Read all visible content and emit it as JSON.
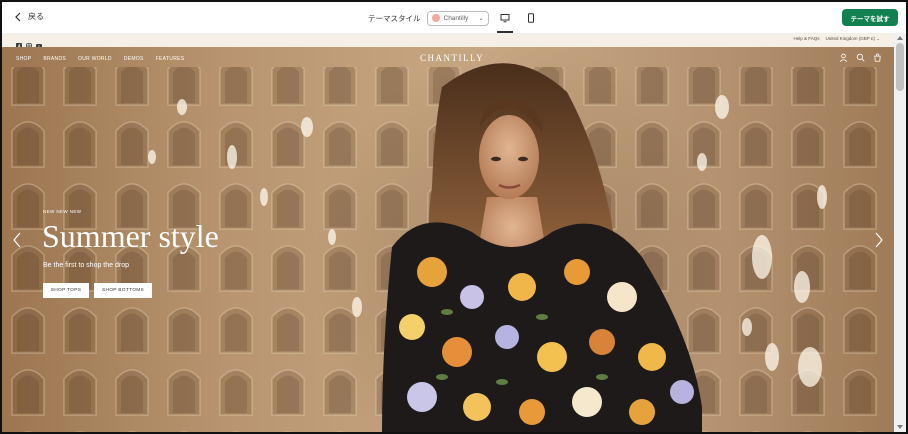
{
  "editor": {
    "back_label": "戻る",
    "theme_style_label": "テーマスタイル",
    "theme_style_value": "Chantilly",
    "theme_style_swatch": "#f4a79d",
    "try_theme_label": "テーマを試す",
    "try_theme_color": "#138050",
    "devices": [
      {
        "name": "desktop",
        "icon": "desktop-icon",
        "active": true
      },
      {
        "name": "mobile",
        "icon": "mobile-icon",
        "active": false
      }
    ]
  },
  "store": {
    "announcement": {
      "social_icons": [
        "facebook-icon",
        "instagram-icon",
        "youtube-icon"
      ],
      "help_label": "Help & FAQs",
      "region_label": "United Kingdom (GBP £)"
    },
    "nav": {
      "items": [
        "SHOP",
        "BRANDS",
        "OUR WORLD",
        "DEMOS",
        "FEATURES"
      ],
      "logo": "CHANTILLY",
      "icons": [
        "account-icon",
        "search-icon",
        "cart-icon"
      ]
    },
    "hero": {
      "kicker": "NEW NEW NEW",
      "headline": "Summer style",
      "subheadline": "Be the first to shop the drop",
      "buttons": [
        "SHOP TOPS",
        "SHOP BOTTOMS"
      ]
    }
  }
}
